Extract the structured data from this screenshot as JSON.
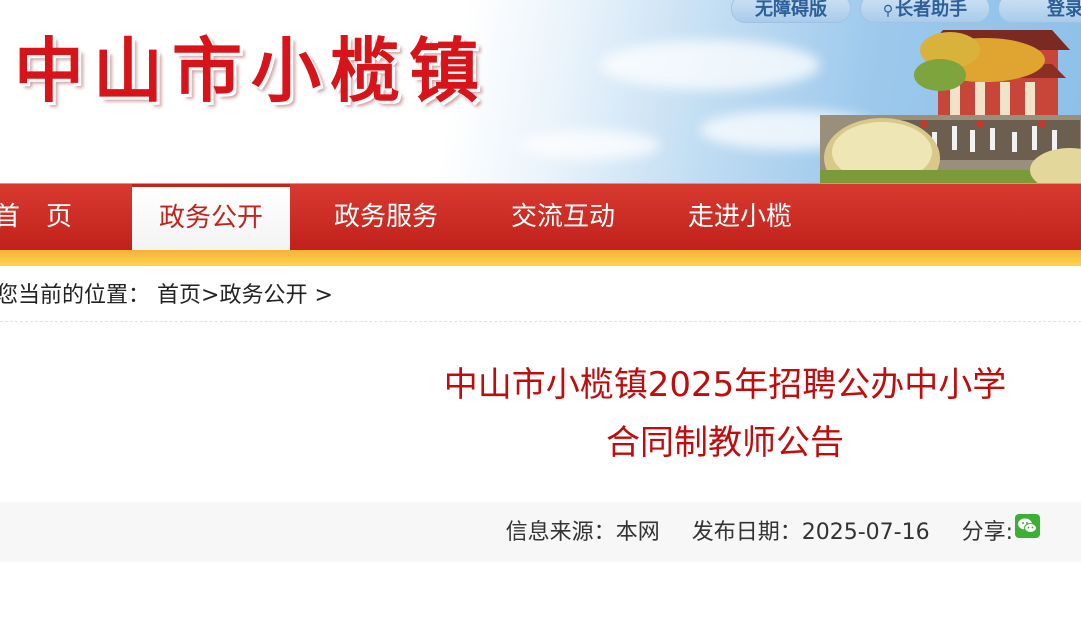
{
  "header": {
    "site_title": "中山市小榄镇",
    "top_links": [
      {
        "label": "无障碍版",
        "icon": ""
      },
      {
        "label": "长者助手",
        "icon": "user-icon"
      },
      {
        "label": "登录",
        "icon": ""
      }
    ]
  },
  "nav": {
    "items": [
      {
        "label": "首　页",
        "active": false
      },
      {
        "label": "政务公开",
        "active": true
      },
      {
        "label": "政务服务",
        "active": false
      },
      {
        "label": "交流互动",
        "active": false
      },
      {
        "label": "走进小榄",
        "active": false
      }
    ]
  },
  "breadcrumb": {
    "prefix": "您当前的位置：",
    "home": "首页",
    "separator1": ">",
    "current": "政务公开",
    "separator2": ">"
  },
  "article": {
    "title_line1": "中山市小榄镇2025年招聘公办中小学",
    "title_line2": "合同制教师公告",
    "source_label": "信息来源：",
    "source_value": "本网",
    "date_label": "发布日期：",
    "date_value": "2025-07-16",
    "share_label": "分享:",
    "share_icon": "wechat-icon"
  },
  "colors": {
    "brand_red": "#c4231b",
    "title_red": "#c00c0c",
    "accent_yellow": "#ffd54a",
    "wechat_green": "#3cb034"
  }
}
